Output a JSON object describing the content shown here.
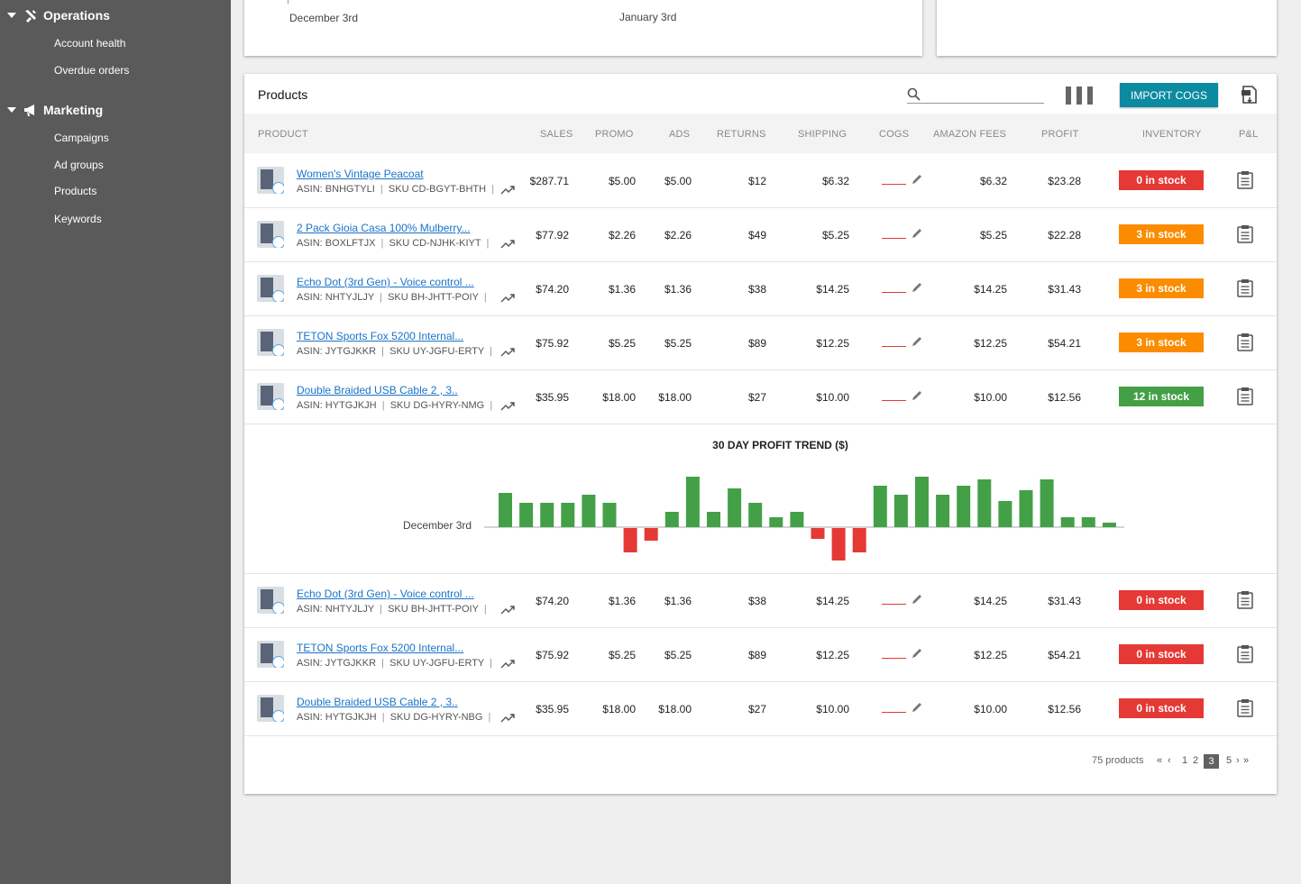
{
  "sidebar": {
    "sections": [
      {
        "label": "Operations",
        "icon": "tools-icon",
        "items": [
          "Account health",
          "Overdue orders"
        ]
      },
      {
        "label": "Marketing",
        "icon": "megaphone-icon",
        "items": [
          "Campaigns",
          "Ad groups",
          "Products",
          "Keywords"
        ]
      }
    ]
  },
  "top_chart": {
    "date_left": "December 3rd",
    "date_right": "January 3rd"
  },
  "products": {
    "title": "Products",
    "search_placeholder": "",
    "import_label": "IMPORT COGS",
    "columns": [
      "PRODUCT",
      "SALES",
      "PROMO",
      "ADS",
      "RETURNS",
      "SHIPPING",
      "COGS",
      "AMAZON FEES",
      "PROFIT",
      "INVENTORY",
      "P&L"
    ],
    "rows": [
      {
        "name": "Women's Vintage Peacoat",
        "asin": "ASIN: BNHGTYLI",
        "sku": "SKU CD-BGYT-BHTH",
        "sales": "$287.71",
        "promo": "$5.00",
        "ads": "$5.00",
        "returns": "$12",
        "shipping": "$6.32",
        "fees": "$6.32",
        "profit": "$23.28",
        "stock": "0 in stock",
        "stock_color": "#e53935"
      },
      {
        "name": "2 Pack Gioia Casa 100% Mulberry...",
        "asin": "ASIN: BOXLFTJX",
        "sku": "SKU CD-NJHK-KIYT",
        "sales": "$77.92",
        "promo": "$2.26",
        "ads": "$2.26",
        "returns": "$49",
        "shipping": "$5.25",
        "fees": "$5.25",
        "profit": "$22.28",
        "stock": "3 in stock",
        "stock_color": "#fb8c00"
      },
      {
        "name": "Echo Dot (3rd Gen) - Voice control ...",
        "asin": "ASIN: NHTYJLJY",
        "sku": "SKU BH-JHTT-POIY",
        "sales": "$74.20",
        "promo": "$1.36",
        "ads": "$1.36",
        "returns": "$38",
        "shipping": "$14.25",
        "fees": "$14.25",
        "profit": "$31.43",
        "stock": "3 in stock",
        "stock_color": "#fb8c00"
      },
      {
        "name": "TETON Sports Fox 5200 Internal...",
        "asin": "ASIN: JYTGJKKR",
        "sku": "SKU UY-JGFU-ERTY",
        "sales": "$75.92",
        "promo": "$5.25",
        "ads": "$5.25",
        "returns": "$89",
        "shipping": "$12.25",
        "fees": "$12.25",
        "profit": "$54.21",
        "stock": "3 in stock",
        "stock_color": "#fb8c00"
      },
      {
        "name": "Double Braided USB Cable 2 , 3..",
        "asin": "ASIN: HYTGJKJH",
        "sku": "SKU DG-HYRY-NMG",
        "sales": "$35.95",
        "promo": "$18.00",
        "ads": "$18.00",
        "returns": "$27",
        "shipping": "$10.00",
        "fees": "$10.00",
        "profit": "$12.56",
        "stock": "12 in stock",
        "stock_color": "#43a047"
      },
      {
        "name": "Echo Dot (3rd Gen) - Voice control ...",
        "asin": "ASIN: NHTYJLJY",
        "sku": "SKU BH-JHTT-POIY",
        "sales": "$74.20",
        "promo": "$1.36",
        "ads": "$1.36",
        "returns": "$38",
        "shipping": "$14.25",
        "fees": "$14.25",
        "profit": "$31.43",
        "stock": "0 in stock",
        "stock_color": "#e53935"
      },
      {
        "name": "TETON Sports Fox 5200 Internal...",
        "asin": "ASIN: JYTGJKKR",
        "sku": "SKU UY-JGFU-ERTY",
        "sales": "$75.92",
        "promo": "$5.25",
        "ads": "$5.25",
        "returns": "$89",
        "shipping": "$12.25",
        "fees": "$12.25",
        "profit": "$54.21",
        "stock": "0 in stock",
        "stock_color": "#e53935"
      },
      {
        "name": "Double Braided USB Cable 2 , 3..",
        "asin": "ASIN: HYTGJKJH",
        "sku": "SKU DG-HYRY-NBG",
        "sales": "$35.95",
        "promo": "$18.00",
        "ads": "$18.00",
        "returns": "$27",
        "shipping": "$10.00",
        "fees": "$10.00",
        "profit": "$12.56",
        "stock": "0 in stock",
        "stock_color": "#e53935"
      }
    ],
    "pagination": {
      "count": "75 products",
      "pages": [
        "1",
        "2",
        "3",
        "5"
      ],
      "active": "3"
    }
  },
  "chart_data": {
    "type": "bar",
    "title": "30 DAY PROFIT TREND ($)",
    "x_start_label": "December 3rd",
    "values": [
      38,
      27,
      27,
      27,
      36,
      27,
      -27,
      -14,
      17,
      56,
      17,
      43,
      27,
      11,
      17,
      -12,
      -36,
      -27,
      46,
      36,
      56,
      36,
      46,
      53,
      29,
      41,
      53,
      11,
      11,
      5
    ],
    "positive_color": "#43a047",
    "negative_color": "#e53935"
  }
}
